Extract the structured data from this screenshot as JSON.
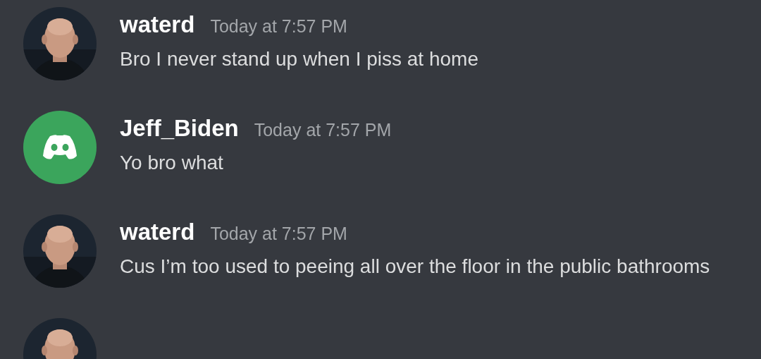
{
  "messages": [
    {
      "author": "waterd",
      "timestamp": "Today at 7:57 PM",
      "text": "Bro I never stand up when I piss at home",
      "avatar": {
        "kind": "picture"
      }
    },
    {
      "author": "Jeff_Biden",
      "timestamp": "Today at 7:57 PM",
      "text": "Yo bro what",
      "avatar": {
        "kind": "default",
        "color": "#3ba55c"
      }
    },
    {
      "author": "waterd",
      "timestamp": "Today at 7:57 PM",
      "text": "Cus I’m too used to peeing all over the floor in the public bathrooms",
      "avatar": {
        "kind": "picture"
      }
    },
    {
      "avatar": {
        "kind": "picture"
      }
    }
  ]
}
